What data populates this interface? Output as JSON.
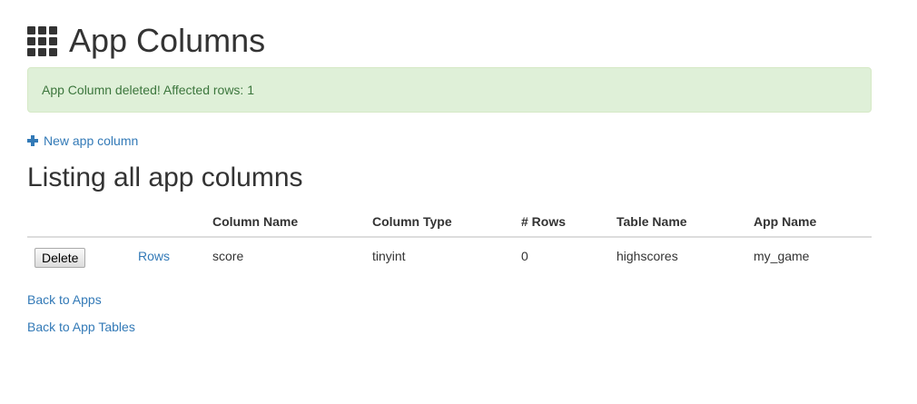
{
  "header": {
    "icon": "grid-icon",
    "title": "App Columns"
  },
  "alert": {
    "message": "App Column deleted! Affected rows: 1",
    "color": "#3c763d",
    "background": "#dff0d8"
  },
  "actions": {
    "new_icon": "plus-icon",
    "new_label": "New app column"
  },
  "listing": {
    "title": "Listing all app columns",
    "headers": [
      "",
      "",
      "Column Name",
      "Column Type",
      "# Rows",
      "Table Name",
      "App Name"
    ],
    "rows": [
      {
        "delete_label": "Delete",
        "rows_link": "Rows",
        "column_name": "score",
        "column_type": "tinyint",
        "row_count": "0",
        "table_name": "highscores",
        "app_name": "my_game"
      }
    ]
  },
  "footer_links": {
    "back_to_apps": "Back to Apps",
    "back_to_app_tables": "Back to App Tables"
  },
  "colors": {
    "link": "#337ab7",
    "text": "#333333"
  }
}
